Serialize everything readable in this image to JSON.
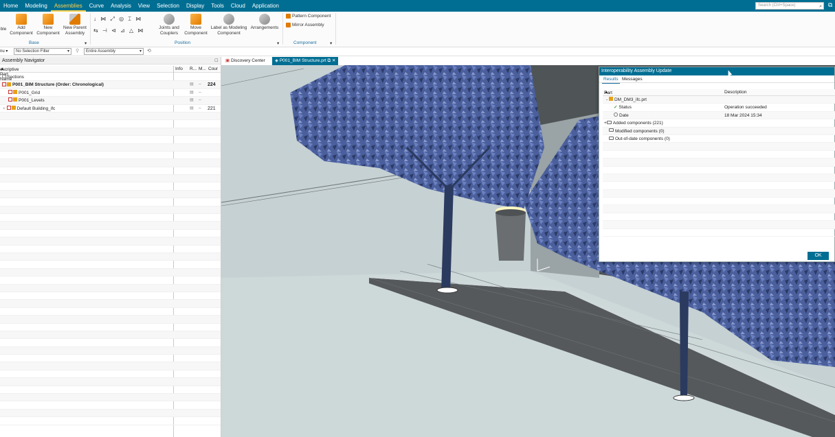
{
  "menubar": {
    "tabs": [
      "Home",
      "Modeling",
      "Assemblies",
      "Curve",
      "Analysis",
      "View",
      "Selection",
      "Display",
      "Tools",
      "Cloud",
      "Application"
    ],
    "active_tab": "Assemblies",
    "search_placeholder": "Search (Ctrl+Space)"
  },
  "ribbon": {
    "table_label": "ble",
    "add_component": "Add Component",
    "new_component": "New Component",
    "new_parent_assembly": "New Parent Assembly",
    "base_group": "Base",
    "joints_couplers": "Joints and Couplers",
    "move_component": "Move Component",
    "label_modeling": "Label as Modeling Component",
    "arrangements": "Arrangements",
    "position_group": "Position",
    "pattern_component": "Pattern Component",
    "mirror_assembly": "Mirror Assembly",
    "component_group": "Component"
  },
  "filterbar": {
    "menu_label": "nu",
    "selection_filter": "No Selection Filter",
    "scope": "Entire Assembly"
  },
  "navigator": {
    "title": "Assembly Navigator",
    "columns": {
      "name": "escriptive Part Name",
      "info": "Info",
      "r": "R...",
      "m": "M...",
      "count": "Cour"
    },
    "rows": [
      {
        "name": "Sections",
        "count": ""
      },
      {
        "name": "P001_BIM Structure (Order: Chronological)",
        "count": "224"
      },
      {
        "name": "P001_Grid",
        "count": ""
      },
      {
        "name": "P001_Levels",
        "count": ""
      },
      {
        "name": "Default Building_ifc",
        "count": "221"
      }
    ]
  },
  "doctabs": {
    "discovery": "Discovery Center",
    "active_part": "P001_BIM Structure.prt"
  },
  "dialog": {
    "title": "Interoperability Assembly Update",
    "tabs": [
      "Results",
      "Messages"
    ],
    "columns": {
      "part": "Part",
      "description": "Description"
    },
    "rows": [
      {
        "part": "DM_DM3_ifc.prt",
        "description": ""
      },
      {
        "part": "Status",
        "description": "Operation succeeded"
      },
      {
        "part": "Date",
        "description": "18 Mar 2024 15:34"
      },
      {
        "part": "Added components (221)",
        "description": ""
      },
      {
        "part": "Modified components (0)",
        "description": ""
      },
      {
        "part": "Out-of-date components (0)",
        "description": ""
      }
    ],
    "ok_label": "OK"
  },
  "colors": {
    "accent": "#006e93",
    "highlight": "#ffd24c",
    "tree_foliage": "#4a5f9c"
  }
}
